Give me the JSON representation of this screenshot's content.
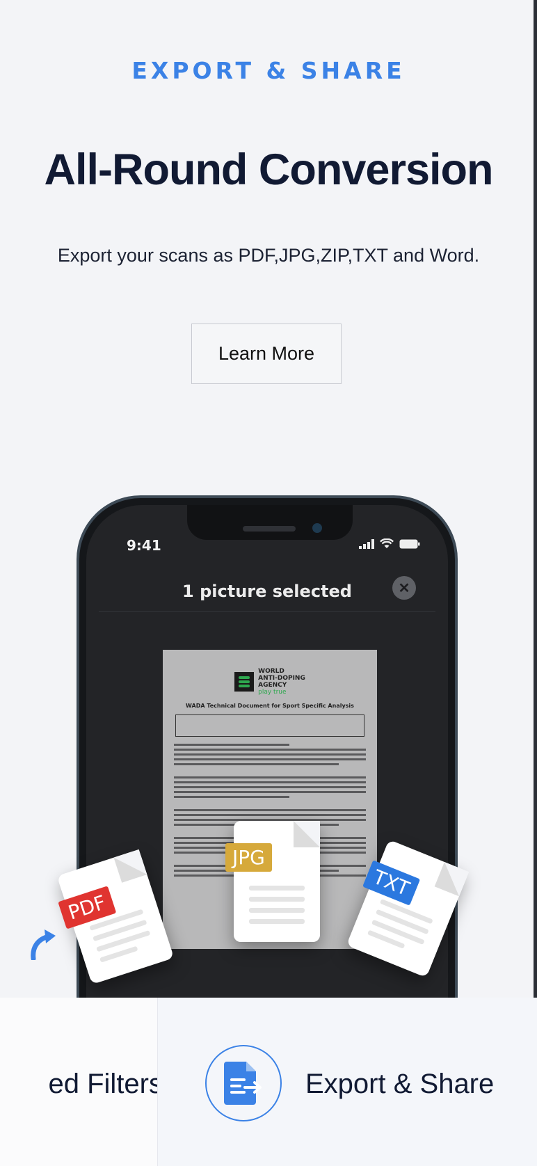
{
  "hero": {
    "eyebrow": "EXPORT & SHARE",
    "title": "All-Round Conversion",
    "subtitle": "Export your scans as PDF,JPG,ZIP,TXT and Word.",
    "cta_label": "Learn More"
  },
  "phone": {
    "time": "9:41",
    "sheet_title": "1 picture selected",
    "close_icon": "close-icon"
  },
  "document": {
    "org_line1": "WORLD",
    "org_line2": "ANTI-DOPING",
    "org_line3": "AGENCY",
    "tagline": "play true",
    "title": "WADA Technical Document for Sport Specific Analysis"
  },
  "formats": {
    "pdf": "PDF",
    "jpg": "JPG",
    "txt": "TXT"
  },
  "bottom_tabs": {
    "filters_label": "ed Filters",
    "export_label": "Export & Share"
  },
  "colors": {
    "accent": "#3b82e6",
    "title": "#111a33",
    "pdf": "#e03430",
    "jpg": "#d6a93b",
    "txt": "#2b78df"
  }
}
